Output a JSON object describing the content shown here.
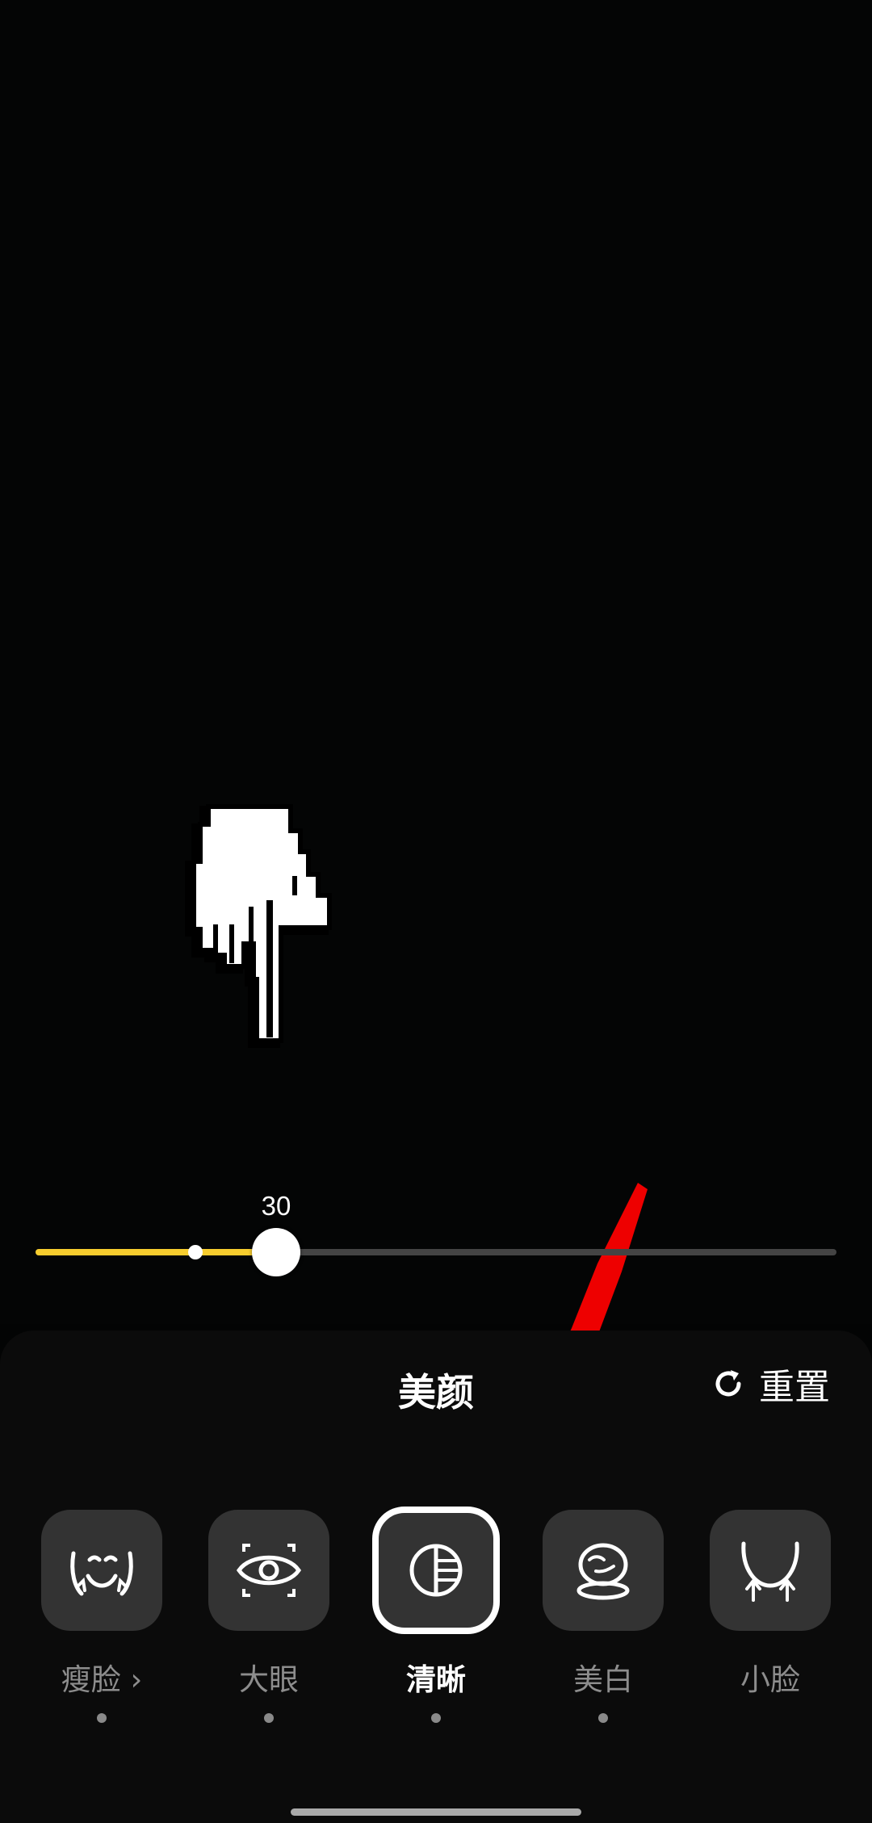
{
  "slider": {
    "value": "30",
    "fill_fraction": 0.3,
    "default_fraction": 0.2
  },
  "panel": {
    "title": "美颜",
    "reset_label": "重置",
    "reset_icon": "refresh-icon"
  },
  "tools": [
    {
      "label": "瘦脸 ›",
      "icon": "face-slim-icon",
      "selected": false,
      "has_dot": true
    },
    {
      "label": "大眼",
      "icon": "eye-icon",
      "selected": false,
      "has_dot": true
    },
    {
      "label": "清晰",
      "icon": "clarity-icon",
      "selected": true,
      "has_dot": true
    },
    {
      "label": "美白",
      "icon": "whiten-icon",
      "selected": false,
      "has_dot": true
    },
    {
      "label": "小脸",
      "icon": "small-face-icon",
      "selected": false,
      "has_dot": false
    }
  ],
  "colors": {
    "accent": "#f7cd2e",
    "annotation_arrow": "#ee0000"
  }
}
